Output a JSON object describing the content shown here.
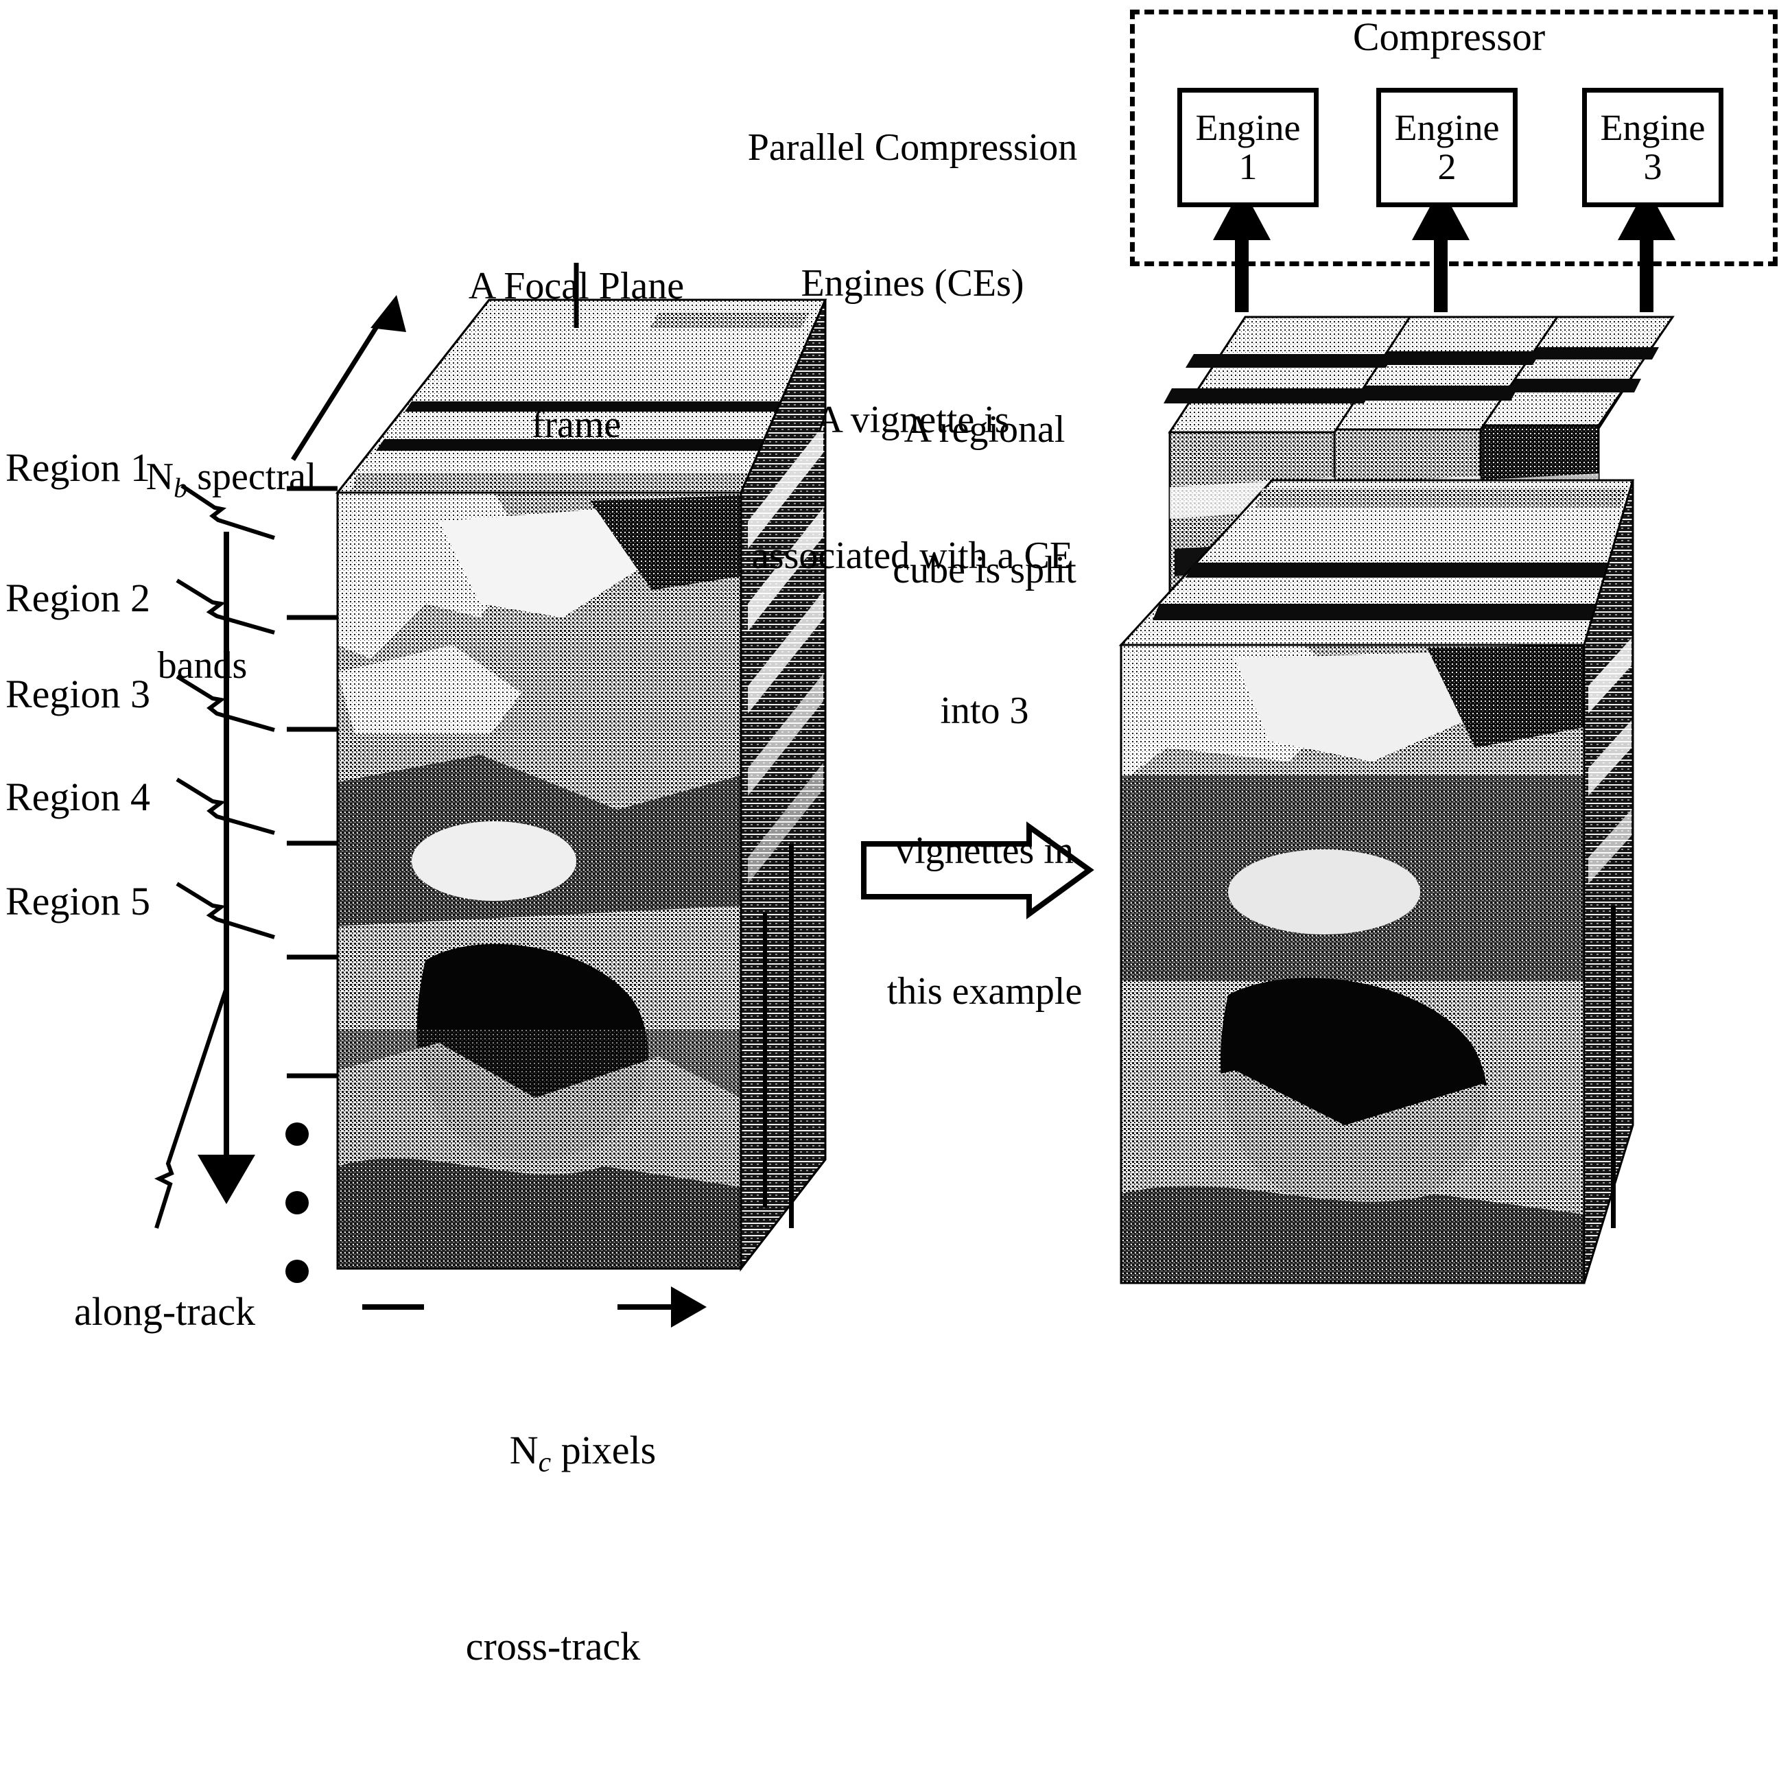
{
  "figure": {
    "domain": "technical-diagram",
    "description": "Hyperspectral data cube partitioned into regions and vignettes feeding parallel compression engines",
    "ink_color": "#000000",
    "background_color": "#ffffff"
  },
  "labels": {
    "spectral_bands_line1_pre": "N",
    "spectral_bands_line1_sub": "b",
    "spectral_bands_line1_post": " spectral",
    "spectral_bands_line2": "bands",
    "focal_plane_line1": "A Focal Plane",
    "focal_plane_line2": "frame",
    "along_track": "along-track",
    "cross_track_pre": "N",
    "cross_track_sub": "c",
    "cross_track_post": " pixels",
    "cross_track_line2": "cross-track",
    "left_dash": "—",
    "right_arrow": "➤"
  },
  "regions": [
    {
      "label": "Region 1"
    },
    {
      "label": "Region 2"
    },
    {
      "label": "Region 3"
    },
    {
      "label": "Region 4"
    },
    {
      "label": "Region 5"
    }
  ],
  "ellipsis": {
    "count": 3,
    "meaning": "more regions continue"
  },
  "center_note": {
    "line1": "Parallel Compression",
    "line2": "Engines (CEs)",
    "line3": "A vignette is",
    "line4": "associated with a CE"
  },
  "split_note": {
    "line1": "A regional",
    "line2": "cube is split",
    "line3": "into 3",
    "line4": "vignettes in",
    "line5": "this example"
  },
  "compressor": {
    "title": "Compressor",
    "engines": [
      {
        "name_line1": "Engine",
        "name_line2": "1"
      },
      {
        "name_line1": "Engine",
        "name_line2": "2"
      },
      {
        "name_line1": "Engine",
        "name_line2": "3"
      }
    ],
    "arrow_count": 3,
    "arrow_direction": "up",
    "enclosure_style": "dashed"
  },
  "transform_arrow": {
    "direction": "right",
    "style": "hollow-block-arrow"
  },
  "cubes": {
    "source": {
      "name": "regional-data-cube",
      "vignettes": 1
    },
    "target": {
      "name": "split-data-cube",
      "vignettes": 3
    }
  }
}
